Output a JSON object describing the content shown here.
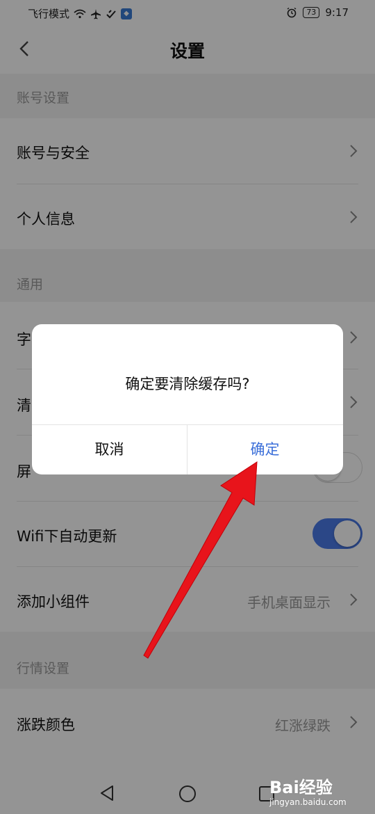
{
  "status_bar": {
    "left_text": "飞行模式",
    "battery": "73",
    "time": "9:17"
  },
  "header": {
    "title": "设置"
  },
  "sections": {
    "account": {
      "title": "账号设置",
      "security": "账号与安全",
      "profile": "个人信息"
    },
    "general": {
      "title": "通用",
      "font_partial": "字",
      "clear_partial": "清",
      "screen_partial": "屏",
      "wifi_update": "Wifi下自动更新",
      "widget": "添加小组件",
      "widget_value": "手机桌面显示"
    },
    "market": {
      "title": "行情设置",
      "color": "涨跌颜色",
      "color_value": "红涨绿跌"
    }
  },
  "toggles": {
    "screen_on": false,
    "wifi_update": true
  },
  "dialog": {
    "message": "确定要清除缓存吗?",
    "cancel": "取消",
    "confirm": "确定"
  },
  "watermark": {
    "brand": "Bai经验",
    "url": "jingyan.baidu.com"
  },
  "colors": {
    "accent": "#4a7ae8",
    "confirm_text": "#3b6fd9",
    "arrow": "#e8141b"
  }
}
